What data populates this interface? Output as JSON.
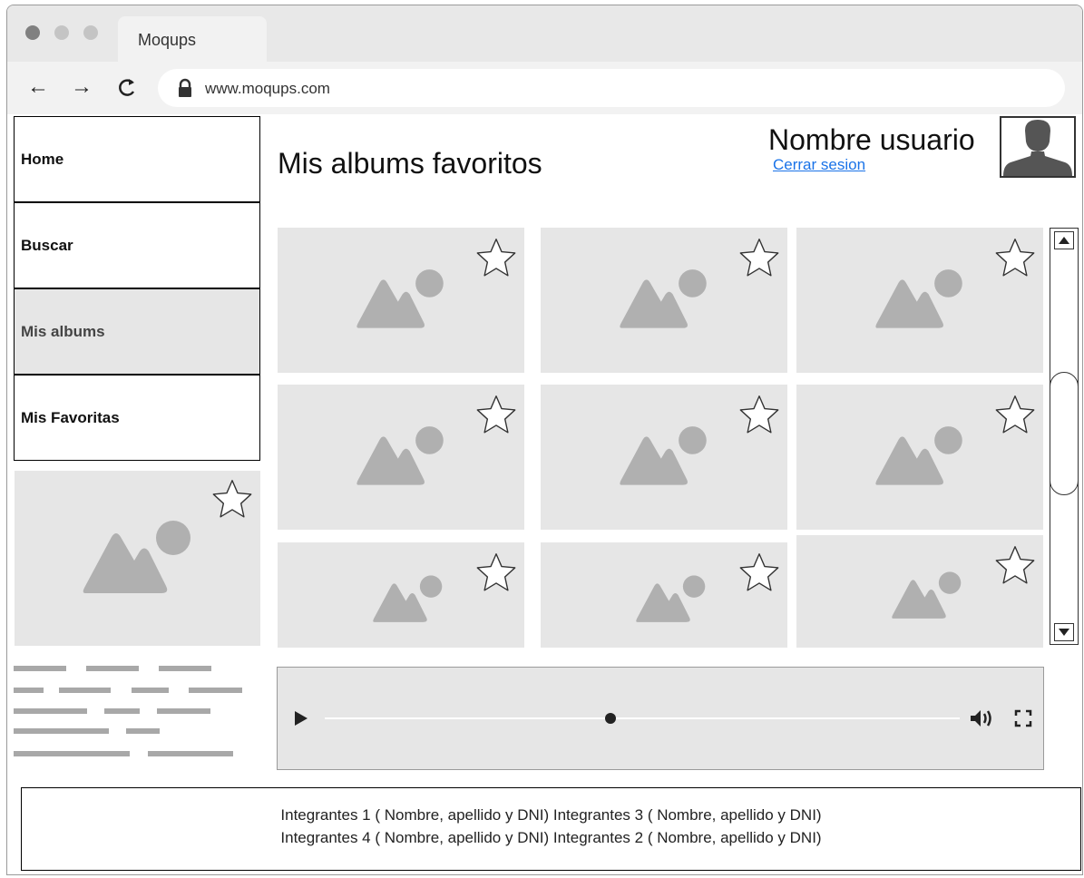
{
  "browser": {
    "tab_title": "Moqups",
    "url": "www.moqups.com",
    "traffic_lights": [
      "#808080",
      "#c4c4c4",
      "#c4c4c4"
    ]
  },
  "sidebar": {
    "items": [
      {
        "label": "Home",
        "active": false
      },
      {
        "label": "Buscar",
        "active": false
      },
      {
        "label": "Mis albums",
        "active": true
      },
      {
        "label": "Mis Favoritas",
        "active": false
      }
    ]
  },
  "header": {
    "title": "Mis albums favoritos",
    "username": "Nombre usuario",
    "logout_label": "Cerrar sesion"
  },
  "album_grid": {
    "items": [
      {
        "icon": "image-placeholder-icon",
        "favorite_icon": "star-icon"
      },
      {
        "icon": "image-placeholder-icon",
        "favorite_icon": "star-icon"
      },
      {
        "icon": "image-placeholder-icon",
        "favorite_icon": "star-icon"
      },
      {
        "icon": "image-placeholder-icon",
        "favorite_icon": "star-icon"
      },
      {
        "icon": "image-placeholder-icon",
        "favorite_icon": "star-icon"
      },
      {
        "icon": "image-placeholder-icon",
        "favorite_icon": "star-icon"
      },
      {
        "icon": "image-placeholder-icon",
        "favorite_icon": "star-icon"
      },
      {
        "icon": "image-placeholder-icon",
        "favorite_icon": "star-icon"
      },
      {
        "icon": "image-placeholder-icon",
        "favorite_icon": "star-icon"
      }
    ]
  },
  "featured": {
    "icon": "image-placeholder-icon",
    "favorite_icon": "star-icon"
  },
  "player": {
    "progress": 0.45,
    "icons": [
      "play-icon",
      "volume-icon",
      "fullscreen-icon"
    ]
  },
  "footer": {
    "line1": "Integrantes 1 ( Nombre, apellido y DNI) Integrantes 3 ( Nombre, apellido y DNI)",
    "line2": "Integrantes 4 ( Nombre, apellido y DNI) Integrantes 2 ( Nombre, apellido y DNI)"
  },
  "colors": {
    "placeholder_bg": "#e6e6e6",
    "placeholder_shape": "#b0b0b0",
    "link": "#1a73e8"
  }
}
